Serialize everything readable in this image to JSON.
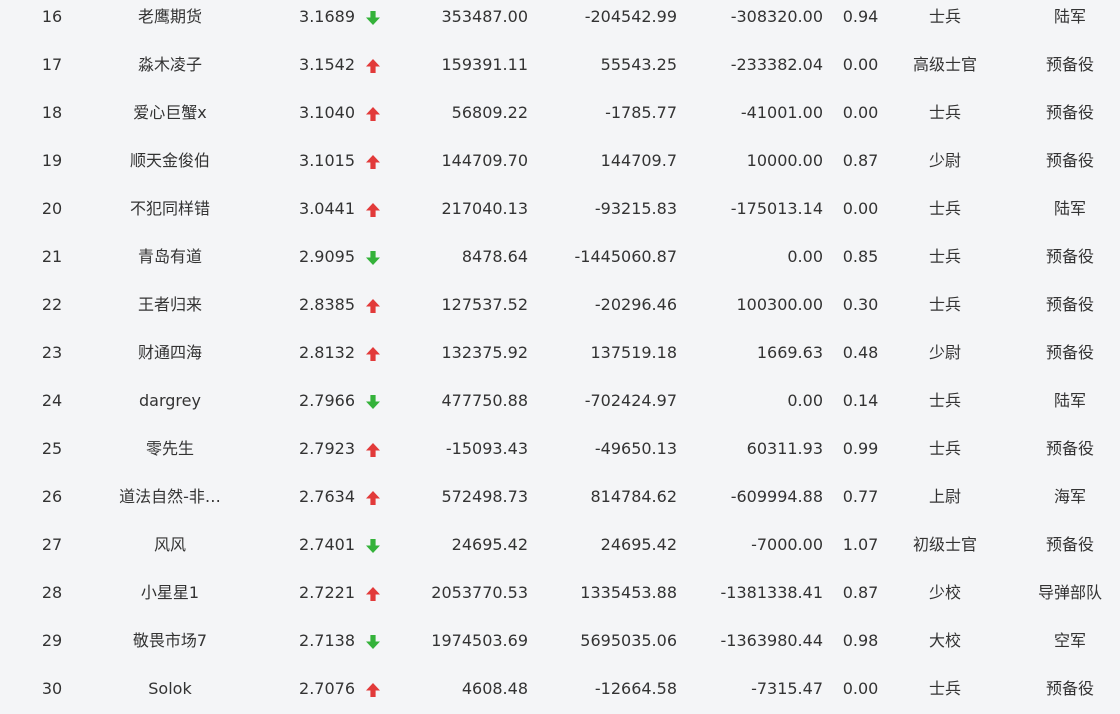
{
  "colors": {
    "up": "#e23a3a",
    "down": "#34b23a"
  },
  "rows": [
    {
      "rank": "16",
      "name": "老鹰期货",
      "score": "3.1689",
      "trend": "down",
      "v1": "353487.00",
      "v2": "-204542.99",
      "v3": "-308320.00",
      "ratio": "0.94",
      "title": "士兵",
      "army": "陆军"
    },
    {
      "rank": "17",
      "name": "淼木凌子",
      "score": "3.1542",
      "trend": "up",
      "v1": "159391.11",
      "v2": "55543.25",
      "v3": "-233382.04",
      "ratio": "0.00",
      "title": "高级士官",
      "army": "预备役"
    },
    {
      "rank": "18",
      "name": "爱心巨蟹x",
      "score": "3.1040",
      "trend": "up",
      "v1": "56809.22",
      "v2": "-1785.77",
      "v3": "-41001.00",
      "ratio": "0.00",
      "title": "士兵",
      "army": "预备役"
    },
    {
      "rank": "19",
      "name": "顺天金俊伯",
      "score": "3.1015",
      "trend": "up",
      "v1": "144709.70",
      "v2": "144709.7",
      "v3": "10000.00",
      "ratio": "0.87",
      "title": "少尉",
      "army": "预备役"
    },
    {
      "rank": "20",
      "name": "不犯同样错",
      "score": "3.0441",
      "trend": "up",
      "v1": "217040.13",
      "v2": "-93215.83",
      "v3": "-175013.14",
      "ratio": "0.00",
      "title": "士兵",
      "army": "陆军"
    },
    {
      "rank": "21",
      "name": "青岛有道",
      "score": "2.9095",
      "trend": "down",
      "v1": "8478.64",
      "v2": "-1445060.87",
      "v3": "0.00",
      "ratio": "0.85",
      "title": "士兵",
      "army": "预备役"
    },
    {
      "rank": "22",
      "name": "王者归来",
      "score": "2.8385",
      "trend": "up",
      "v1": "127537.52",
      "v2": "-20296.46",
      "v3": "100300.00",
      "ratio": "0.30",
      "title": "士兵",
      "army": "预备役"
    },
    {
      "rank": "23",
      "name": "财通四海",
      "score": "2.8132",
      "trend": "up",
      "v1": "132375.92",
      "v2": "137519.18",
      "v3": "1669.63",
      "ratio": "0.48",
      "title": "少尉",
      "army": "预备役"
    },
    {
      "rank": "24",
      "name": "dargrey",
      "score": "2.7966",
      "trend": "down",
      "v1": "477750.88",
      "v2": "-702424.97",
      "v3": "0.00",
      "ratio": "0.14",
      "title": "士兵",
      "army": "陆军"
    },
    {
      "rank": "25",
      "name": "零先生",
      "score": "2.7923",
      "trend": "up",
      "v1": "-15093.43",
      "v2": "-49650.13",
      "v3": "60311.93",
      "ratio": "0.99",
      "title": "士兵",
      "army": "预备役"
    },
    {
      "rank": "26",
      "name": "道法自然-非…",
      "score": "2.7634",
      "trend": "up",
      "v1": "572498.73",
      "v2": "814784.62",
      "v3": "-609994.88",
      "ratio": "0.77",
      "title": "上尉",
      "army": "海军"
    },
    {
      "rank": "27",
      "name": "风风",
      "score": "2.7401",
      "trend": "down",
      "v1": "24695.42",
      "v2": "24695.42",
      "v3": "-7000.00",
      "ratio": "1.07",
      "title": "初级士官",
      "army": "预备役"
    },
    {
      "rank": "28",
      "name": "小星星1",
      "score": "2.7221",
      "trend": "up",
      "v1": "2053770.53",
      "v2": "1335453.88",
      "v3": "-1381338.41",
      "ratio": "0.87",
      "title": "少校",
      "army": "导弹部队"
    },
    {
      "rank": "29",
      "name": "敬畏市场7",
      "score": "2.7138",
      "trend": "down",
      "v1": "1974503.69",
      "v2": "5695035.06",
      "v3": "-1363980.44",
      "ratio": "0.98",
      "title": "大校",
      "army": "空军"
    },
    {
      "rank": "30",
      "name": "Solok",
      "score": "2.7076",
      "trend": "up",
      "v1": "4608.48",
      "v2": "-12664.58",
      "v3": "-7315.47",
      "ratio": "0.00",
      "title": "士兵",
      "army": "预备役"
    }
  ]
}
